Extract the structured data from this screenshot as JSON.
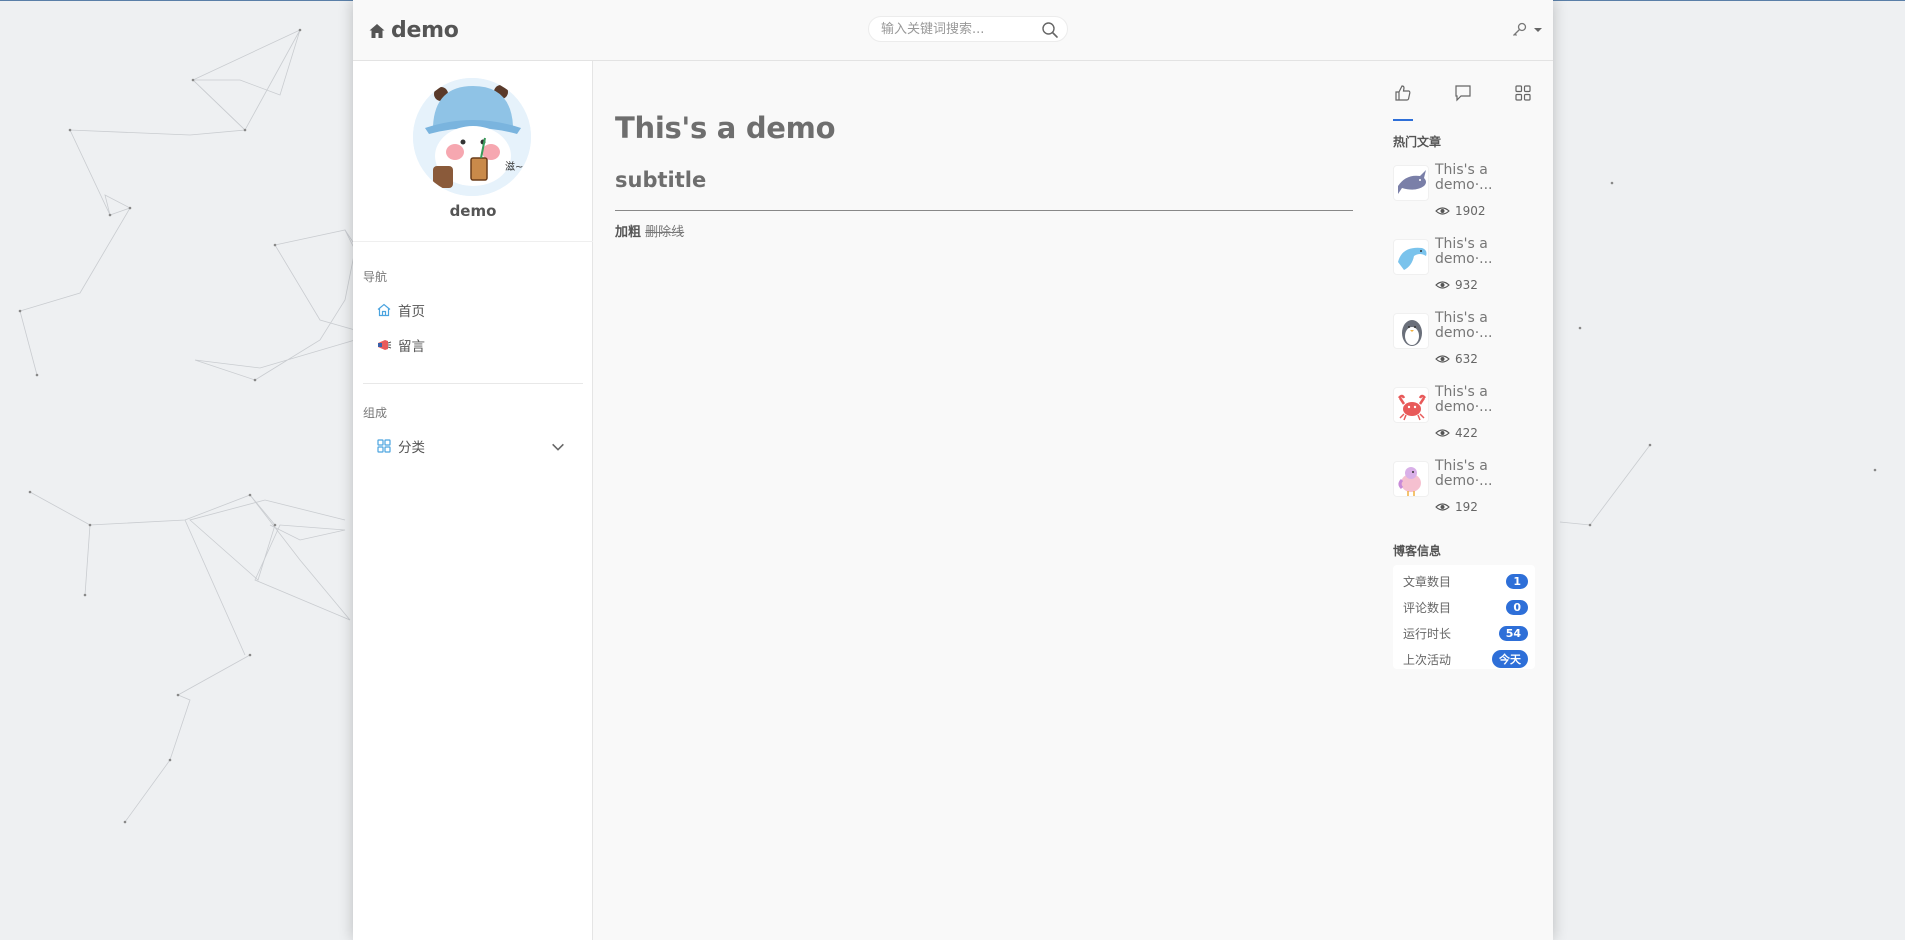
{
  "header": {
    "title": "demo",
    "search_placeholder": "输入关键词搜索..."
  },
  "sidebar": {
    "username": "demo",
    "nav_header": "导航",
    "nav_items": [
      {
        "label": "首页",
        "icon": "home-icon"
      },
      {
        "label": "留言",
        "icon": "megaphone-icon"
      }
    ],
    "compose_header": "组成",
    "compose_items": [
      {
        "label": "分类",
        "icon": "grid-icon"
      }
    ]
  },
  "post": {
    "title": "This's a demo",
    "subtitle": "subtitle",
    "bold_text": "加粗",
    "strike_text": "删除线"
  },
  "aside": {
    "tabs": [
      "thumbs-up-icon",
      "comment-icon",
      "grid-icon"
    ],
    "hot_title": "热门文章",
    "hot_posts": [
      {
        "title": "This's a demo·...",
        "views": "1902",
        "thumb": "shark"
      },
      {
        "title": "This's a demo·...",
        "views": "932",
        "thumb": "dolphin"
      },
      {
        "title": "This's a demo·...",
        "views": "632",
        "thumb": "penguin"
      },
      {
        "title": "This's a demo·...",
        "views": "422",
        "thumb": "crab"
      },
      {
        "title": "This's a demo·...",
        "views": "192",
        "thumb": "bird"
      }
    ],
    "info_title": "博客信息",
    "info": [
      {
        "label": "文章数目",
        "value": "1"
      },
      {
        "label": "评论数目",
        "value": "0"
      },
      {
        "label": "运行时长",
        "value": "54"
      },
      {
        "label": "上次活动",
        "value": "今天"
      }
    ]
  },
  "colors": {
    "accent": "#2e6fd8",
    "page_bg": "#eef0f2",
    "card_bg": "#f9f9f9"
  }
}
